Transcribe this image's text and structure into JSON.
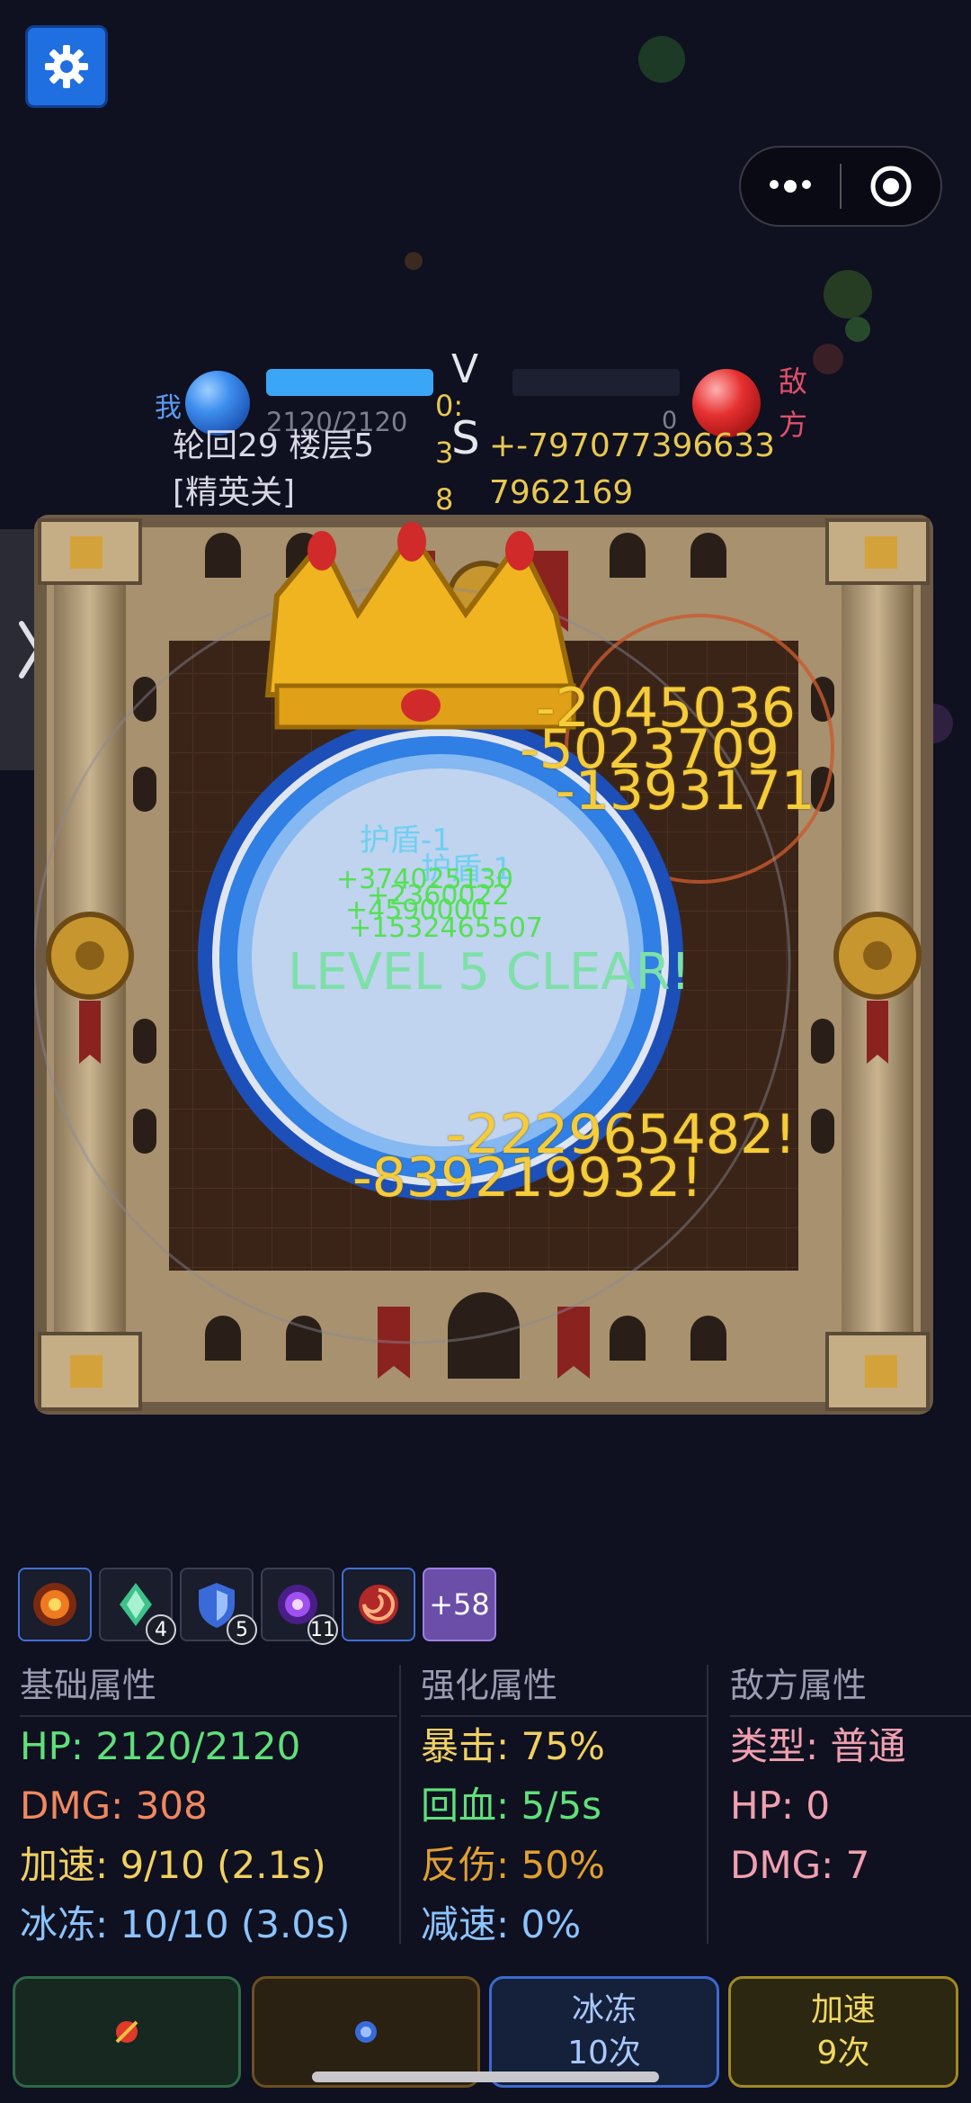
{
  "header": {
    "player_label": "我",
    "enemy_label": "敌方",
    "player_hp_text": "2120/2120",
    "player_hp_fraction": 1.0,
    "enemy_hp_text": "0",
    "enemy_hp_fraction": 0.0,
    "vs_v": "V",
    "vs_s": "S",
    "timer": "0:38",
    "stage": "轮回29 楼层5 [精英关]",
    "score": "+-797077396633 7962169"
  },
  "arena": {
    "damage_numbers": [
      "-2045036",
      "-5023709",
      "-1393171",
      "-222965482!",
      "-839219932!"
    ],
    "heal_numbers": [
      "+374025130",
      "+2360022",
      "+4590000",
      "+1532465507"
    ],
    "shield_texts": [
      "护盾-1",
      "护盾-1"
    ],
    "level_clear": "LEVEL 5 CLEAR!"
  },
  "skills": [
    {
      "name": "fire-orb-skill",
      "count": ""
    },
    {
      "name": "green-crystal-skill",
      "count": "4"
    },
    {
      "name": "blue-shield-skill",
      "count": "5"
    },
    {
      "name": "purple-vortex-skill",
      "count": "11"
    },
    {
      "name": "red-swirl-skill",
      "count": ""
    }
  ],
  "skills_more": "+58",
  "stats": {
    "base": {
      "title": "基础属性",
      "hp": "HP: 2120/2120",
      "dmg": "DMG: 308",
      "speed": "加速: 9/10 (2.1s)",
      "freeze": "冰冻: 10/10 (3.0s)"
    },
    "enhanced": {
      "title": "强化属性",
      "crit": "暴击: 75%",
      "regen": "回血: 5/5s",
      "reflect": "反伤: 50%",
      "slow": "减速: 0%"
    },
    "enemy": {
      "title": "敌方属性",
      "type": "类型: 普通",
      "hp": "HP: 0",
      "dmg": "DMG: 7"
    }
  },
  "buttons": {
    "freeze_label": "冰冻",
    "freeze_count": "10次",
    "speed_label": "加速",
    "speed_count": "9次"
  },
  "colors": {
    "hp_green": "#5fe07a",
    "dmg_orange": "#f08860",
    "speed_yellow": "#f0d060",
    "freeze_blue": "#8cc4ff",
    "enemy_pink": "#f0a0b0"
  }
}
